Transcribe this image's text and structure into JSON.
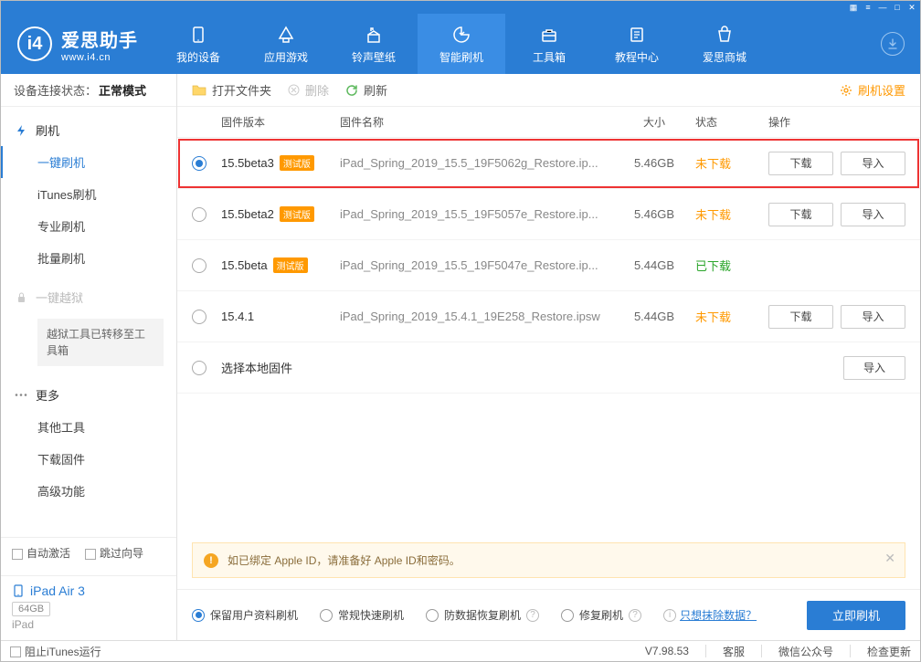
{
  "app": {
    "name": "爱思助手",
    "url": "www.i4.cn"
  },
  "nav": {
    "tabs": [
      {
        "label": "我的设备"
      },
      {
        "label": "应用游戏"
      },
      {
        "label": "铃声壁纸"
      },
      {
        "label": "智能刷机"
      },
      {
        "label": "工具箱"
      },
      {
        "label": "教程中心"
      },
      {
        "label": "爱思商城"
      }
    ],
    "active_index": 3
  },
  "sidebar": {
    "conn_label": "设备连接状态：",
    "conn_value": "正常模式",
    "flash": {
      "title": "刷机",
      "items": [
        "一键刷机",
        "iTunes刷机",
        "专业刷机",
        "批量刷机"
      ]
    },
    "jailbreak_title": "一键越狱",
    "jailbreak_note": "越狱工具已转移至工具箱",
    "more": {
      "title": "更多",
      "items": [
        "其他工具",
        "下载固件",
        "高级功能"
      ]
    },
    "bottom": {
      "auto_activate": "自动激活",
      "skip": "跳过向导"
    }
  },
  "device": {
    "name": "iPad Air 3",
    "capacity": "64GB",
    "type": "iPad"
  },
  "toolbar": {
    "open_folder": "打开文件夹",
    "delete": "删除",
    "refresh": "刷新",
    "settings": "刷机设置"
  },
  "columns": {
    "version": "固件版本",
    "name": "固件名称",
    "size": "大小",
    "status": "状态",
    "ops": "操作"
  },
  "rows": [
    {
      "version": "15.5beta3",
      "beta": "测试版",
      "name": "iPad_Spring_2019_15.5_19F5062g_Restore.ip...",
      "size": "5.46GB",
      "status": "未下载",
      "download": "下载",
      "import": "导入",
      "selected": true,
      "highlight": true
    },
    {
      "version": "15.5beta2",
      "beta": "测试版",
      "name": "iPad_Spring_2019_15.5_19F5057e_Restore.ip...",
      "size": "5.46GB",
      "status": "未下载",
      "download": "下载",
      "import": "导入"
    },
    {
      "version": "15.5beta",
      "beta": "测试版",
      "name": "iPad_Spring_2019_15.5_19F5047e_Restore.ip...",
      "size": "5.44GB",
      "status": "已下载"
    },
    {
      "version": "15.4.1",
      "name": "iPad_Spring_2019_15.4.1_19E258_Restore.ipsw",
      "size": "5.44GB",
      "status": "未下载",
      "download": "下载",
      "import": "导入"
    },
    {
      "version": "选择本地固件",
      "local": true,
      "import": "导入"
    }
  ],
  "notice": "如已绑定 Apple ID，请准备好 Apple ID和密码。",
  "action": {
    "opts": [
      {
        "label": "保留用户资料刷机",
        "sel": true
      },
      {
        "label": "常规快速刷机"
      },
      {
        "label": "防数据恢复刷机",
        "q": true
      },
      {
        "label": "修复刷机",
        "q": true
      }
    ],
    "link": "只想抹除数据？",
    "button": "立即刷机"
  },
  "statusbar": {
    "block_itunes": "阻止iTunes运行",
    "version": "V7.98.53",
    "items": [
      "客服",
      "微信公众号",
      "检查更新"
    ]
  }
}
